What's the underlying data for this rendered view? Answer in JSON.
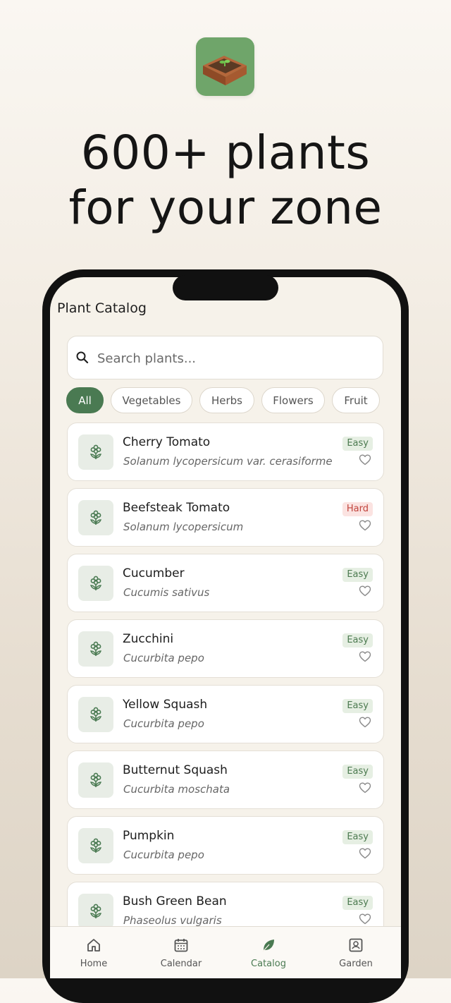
{
  "promo": {
    "headline_line1": "600+ plants",
    "headline_line2": "for your zone"
  },
  "screen": {
    "title": "Plant Catalog",
    "search_placeholder": "Search plants..."
  },
  "filters": [
    {
      "label": "All",
      "active": true
    },
    {
      "label": "Vegetables",
      "active": false
    },
    {
      "label": "Herbs",
      "active": false
    },
    {
      "label": "Flowers",
      "active": false
    },
    {
      "label": "Fruit",
      "active": false
    }
  ],
  "plants": [
    {
      "name": "Cherry Tomato",
      "scientific": "Solanum lycopersicum var. cerasiforme",
      "difficulty": "Easy"
    },
    {
      "name": "Beefsteak Tomato",
      "scientific": "Solanum lycopersicum",
      "difficulty": "Hard"
    },
    {
      "name": "Cucumber",
      "scientific": "Cucumis sativus",
      "difficulty": "Easy"
    },
    {
      "name": "Zucchini",
      "scientific": "Cucurbita pepo",
      "difficulty": "Easy"
    },
    {
      "name": "Yellow Squash",
      "scientific": "Cucurbita pepo",
      "difficulty": "Easy"
    },
    {
      "name": "Butternut Squash",
      "scientific": "Cucurbita moschata",
      "difficulty": "Easy"
    },
    {
      "name": "Pumpkin",
      "scientific": "Cucurbita pepo",
      "difficulty": "Easy"
    },
    {
      "name": "Bush Green Bean",
      "scientific": "Phaseolus vulgaris",
      "difficulty": "Easy"
    }
  ],
  "nav": [
    {
      "label": "Home",
      "icon": "home-icon",
      "active": false
    },
    {
      "label": "Calendar",
      "icon": "calendar-icon",
      "active": false
    },
    {
      "label": "Catalog",
      "icon": "leaf-icon",
      "active": true
    },
    {
      "label": "Garden",
      "icon": "garden-icon",
      "active": false
    }
  ],
  "colors": {
    "accent": "#4a7a52",
    "easy_badge_bg": "#e6efe3",
    "hard_badge_bg": "#fbe3e1",
    "app_icon_bg": "#6fa56a"
  }
}
